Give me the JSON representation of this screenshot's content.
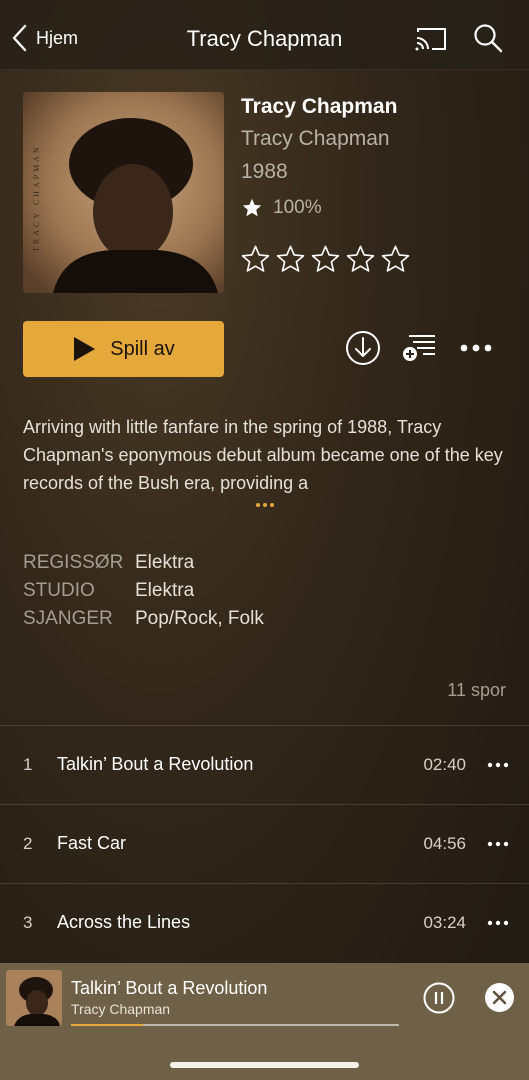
{
  "header": {
    "back_label": "Hjem",
    "title": "Tracy Chapman",
    "icons": [
      "chevron-left-icon",
      "cast-icon",
      "search-icon"
    ]
  },
  "album": {
    "title": "Tracy Chapman",
    "artist": "Tracy Chapman",
    "year": "1988",
    "rating_percent": "100%",
    "user_rating_stars": 0,
    "user_rating_max": 5,
    "cover_text": "TRACY CHAPMAN"
  },
  "actions": {
    "play_label": "Spill av",
    "icons": [
      "play-icon",
      "download-icon",
      "add-to-queue-icon",
      "more-icon"
    ]
  },
  "description": {
    "text": "Arriving with little fanfare in the spring of 1988, Tracy Chapman's eponymous debut album became one of the key records of the Bush era, providing a"
  },
  "meta": [
    {
      "label": "REGISSØR",
      "value": "Elektra"
    },
    {
      "label": "STUDIO",
      "value": "Elektra"
    },
    {
      "label": "SJANGER",
      "value": "Pop/Rock, Folk"
    }
  ],
  "track_count": "11 spor",
  "tracks": [
    {
      "num": "1",
      "title": "Talkin’ Bout a Revolution",
      "duration": "02:40"
    },
    {
      "num": "2",
      "title": "Fast Car",
      "duration": "04:56"
    },
    {
      "num": "3",
      "title": "Across the Lines",
      "duration": "03:24"
    }
  ],
  "mini_player": {
    "title": "Talkin’ Bout a Revolution",
    "artist": "Tracy Chapman",
    "progress": 0.22
  },
  "colors": {
    "accent": "#e5a83a",
    "secondary_text": "#b9b1a6",
    "mini_player_bg": "#6f6147"
  }
}
